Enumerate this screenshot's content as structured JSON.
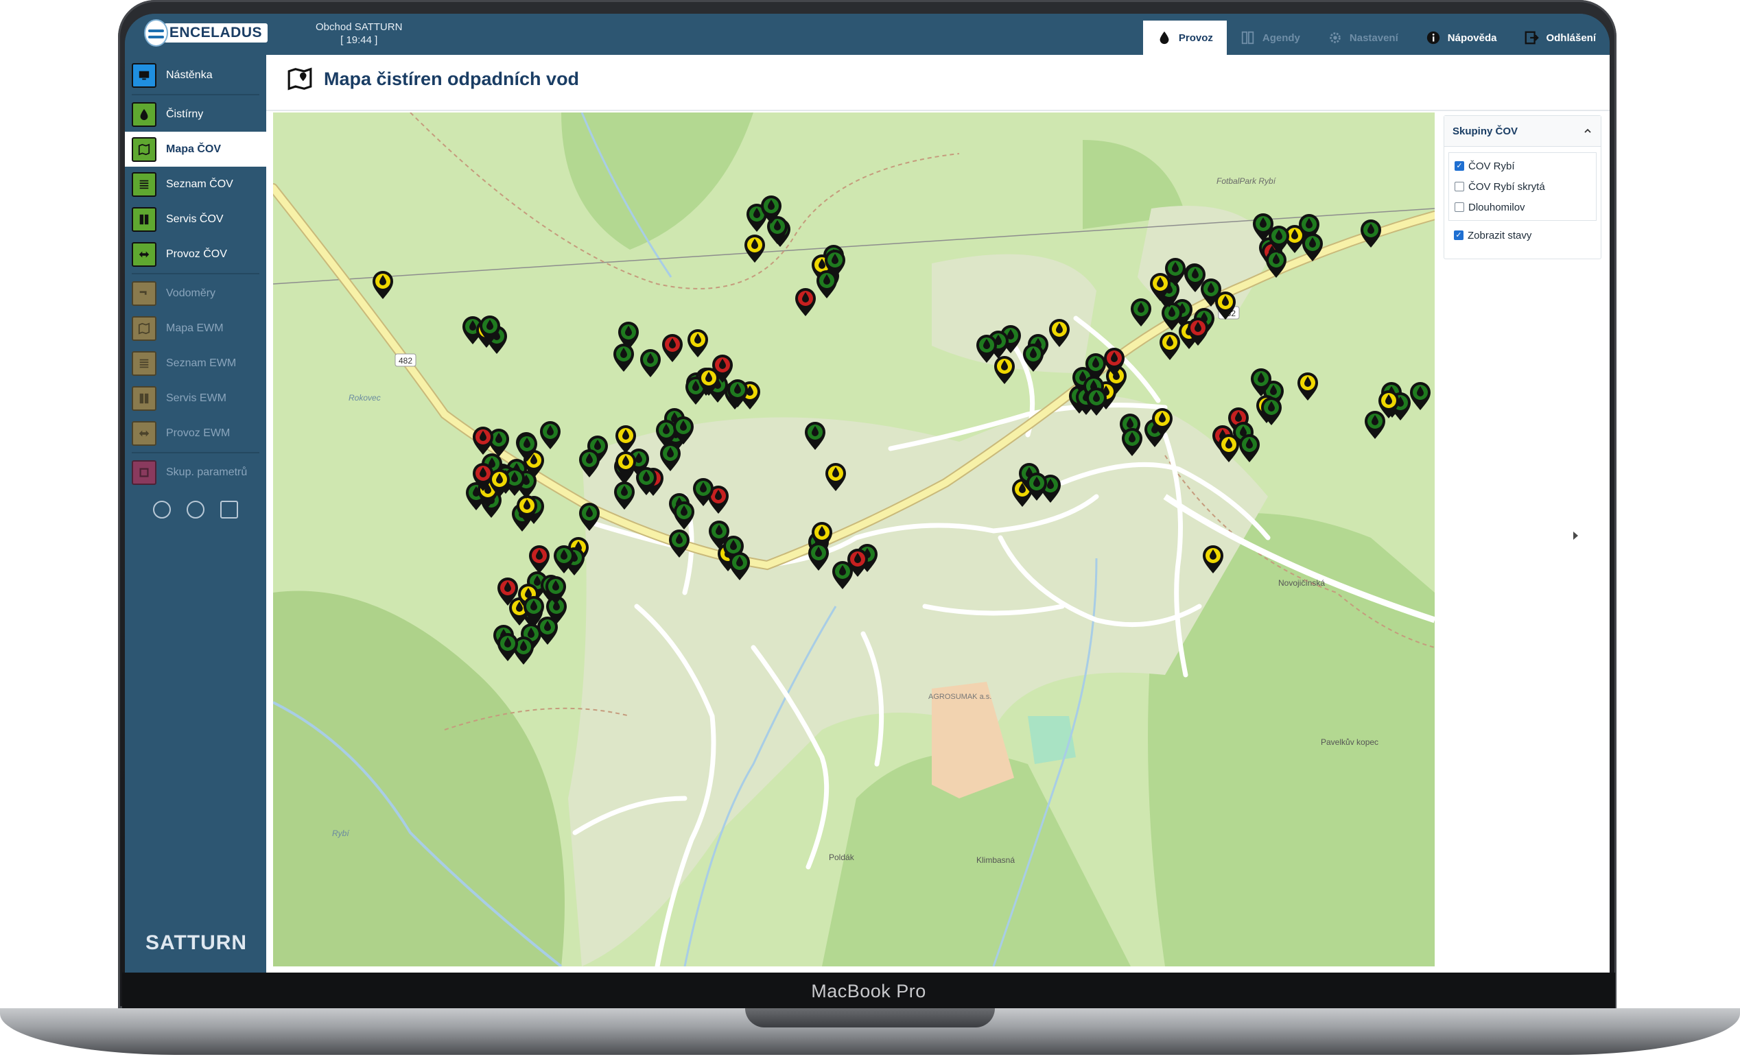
{
  "device": {
    "label": "MacBook Pro"
  },
  "header": {
    "logo_text": "ENCELADUS",
    "shop_name": "Obchod SATTURN",
    "shop_time": "[ 19:44 ]",
    "tabs": [
      {
        "label": "Provoz",
        "icon": "drop-icon",
        "active": true
      },
      {
        "label": "Agendy",
        "icon": "binders-icon",
        "active": false
      },
      {
        "label": "Nastavení",
        "icon": "gear-icon",
        "active": false
      },
      {
        "label": "Nápověda",
        "icon": "info-icon",
        "active": false
      },
      {
        "label": "Odhlášení",
        "icon": "logout-icon",
        "active": false
      }
    ]
  },
  "sidebar": {
    "items": [
      {
        "label": "Nástěnka",
        "icon": "monitor-icon"
      },
      {
        "label": "Čistírny",
        "icon": "drop-icon"
      },
      {
        "label": "Mapa ČOV",
        "icon": "map-icon",
        "active": true
      },
      {
        "label": "Seznam ČOV",
        "icon": "list-icon"
      },
      {
        "label": "Servis ČOV",
        "icon": "binders-icon"
      },
      {
        "label": "Provoz ČOV",
        "icon": "arrows-icon"
      },
      {
        "label": "Vodoměry",
        "icon": "faucet-icon"
      },
      {
        "label": "Mapa EWM",
        "icon": "map-icon"
      },
      {
        "label": "Seznam EWM",
        "icon": "list-icon"
      },
      {
        "label": "Servis EWM",
        "icon": "binders-icon"
      },
      {
        "label": "Provoz EWM",
        "icon": "arrows-icon"
      },
      {
        "label": "Skup. parametrů",
        "icon": "group-icon"
      }
    ],
    "small_icons": [
      "compass-icon",
      "user-icon",
      "logout-icon"
    ],
    "brand": "SATTURN"
  },
  "page": {
    "title": "Mapa čistíren odpadních vod"
  },
  "map": {
    "road_number": "482",
    "labels": [
      "FotbalPark Rybí",
      "Rokovec",
      "Novojičínská",
      "AGROSUMAK a.s.",
      "Pavelkův kopec",
      "Poldák",
      "Klimbasná",
      "Rybí"
    ],
    "status_colors": {
      "green": "#1f7a1f",
      "yellow": "#f0d800",
      "red": "#c62020"
    }
  },
  "groups_panel": {
    "title": "Skupiny ČOV",
    "groups": [
      {
        "label": "ČOV Rybí",
        "checked": true
      },
      {
        "label": "ČOV Rybí skrytá",
        "checked": false
      },
      {
        "label": "Dlouhomilov",
        "checked": false
      }
    ],
    "show_states": {
      "label": "Zobrazit stavy",
      "checked": true
    }
  }
}
